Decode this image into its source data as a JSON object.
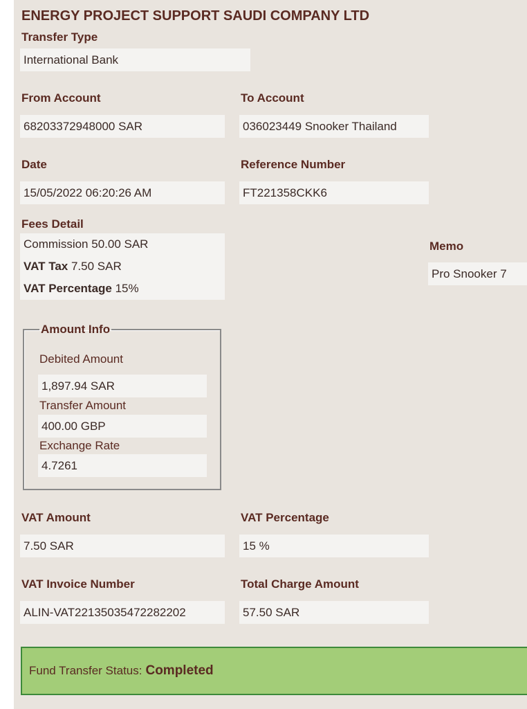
{
  "company_name": "ENERGY PROJECT SUPPORT SAUDI COMPANY LTD",
  "transfer_type": {
    "label": "Transfer Type",
    "value": "International Bank"
  },
  "from_account": {
    "label": "From Account",
    "value": "68203372948000 SAR"
  },
  "to_account": {
    "label": "To Account",
    "value": "036023449 Snooker Thailand"
  },
  "date": {
    "label": "Date",
    "value": "15/05/2022 06:20:26 AM"
  },
  "reference_number": {
    "label": "Reference Number",
    "value": "FT221358CKK6"
  },
  "fees_detail": {
    "label": "Fees Detail",
    "commission": "Commission 50.00 SAR",
    "vat_tax_label": "VAT Tax",
    "vat_tax_value": " 7.50 SAR",
    "vat_percentage_label": "VAT Percentage",
    "vat_percentage_value": " 15%"
  },
  "memo": {
    "label": "Memo",
    "value": "Pro Snooker 7"
  },
  "amount_info": {
    "legend": "Amount Info",
    "debited_amount_label": "Debited Amount",
    "debited_amount_value": "1,897.94 SAR",
    "transfer_amount_label": "Transfer Amount",
    "transfer_amount_value": "400.00 GBP",
    "exchange_rate_label": "Exchange Rate",
    "exchange_rate_value": "4.7261"
  },
  "vat_amount": {
    "label": "VAT Amount",
    "value": "7.50 SAR"
  },
  "vat_percentage": {
    "label": "VAT Percentage",
    "value": "15 %"
  },
  "vat_invoice_number": {
    "label": "VAT Invoice Number",
    "value": "ALIN-VAT22135035472282202"
  },
  "total_charge_amount": {
    "label": "Total Charge Amount",
    "value": "57.50 SAR"
  },
  "status": {
    "label": "Fund Transfer Status:",
    "value": "Completed",
    "color": "#a3cd78"
  }
}
